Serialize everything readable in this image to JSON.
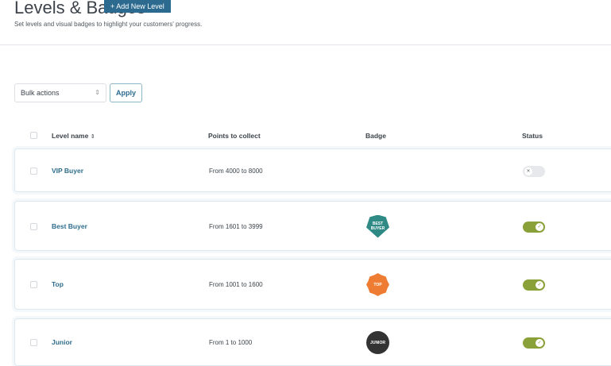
{
  "header": {
    "title": "Levels & Badges",
    "add_button": "+ Add New Level",
    "subtitle": "Set levels and visual badges to highlight your customers' progress."
  },
  "toolbar": {
    "bulk_actions": "Bulk actions",
    "apply": "Apply"
  },
  "table": {
    "columns": [
      "Level name",
      "Points to collect",
      "Badge",
      "Status"
    ],
    "rows": [
      {
        "name": "VIP Buyer",
        "points": "From 4000 to 8000",
        "badge": null,
        "badge_color": null,
        "status": false
      },
      {
        "name": "Best Buyer",
        "points": "From 1601 to 3999",
        "badge": "BEST BUYER",
        "badge_color": "#2f8a86",
        "status": true
      },
      {
        "name": "Top",
        "points": "From 1001 to 1600",
        "badge": "TOP",
        "badge_color": "#ee7d33",
        "status": true
      },
      {
        "name": "Junior",
        "points": "From 1 to 1000",
        "badge": "JUNIOR",
        "badge_color": "#333333",
        "status": true
      }
    ]
  },
  "colors": {
    "accent": "#2c6b8f",
    "toggle_on": "#8aa13a"
  }
}
